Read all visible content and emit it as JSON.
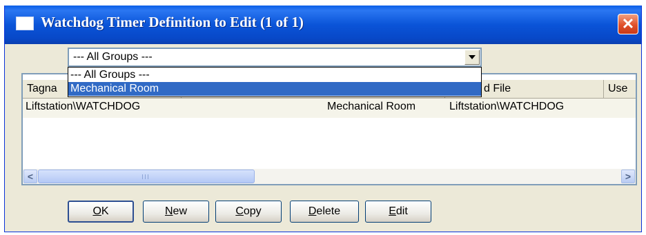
{
  "window": {
    "title": "Watchdog Timer Definition to Edit (1 of 1)",
    "close_glyph": "✕",
    "icons": {
      "app": "window-icon",
      "close": "close-icon"
    }
  },
  "group_filter": {
    "selected": "--- All Groups ---",
    "options": [
      "--- All Groups ---",
      "Mechanical Room"
    ],
    "highlighted": "Mechanical Room"
  },
  "table": {
    "columns": [
      "Tagna",
      "d File",
      "Use"
    ],
    "rows": [
      {
        "tagname": "Liftstation\\WATCHDOG",
        "group": "Mechanical Room",
        "file": "Liftstation\\WATCHDOG"
      }
    ]
  },
  "scrollbar": {
    "left_glyph": "<",
    "right_glyph": ">"
  },
  "buttons": {
    "ok": {
      "key": "O",
      "rest": "K"
    },
    "new": {
      "key": "N",
      "rest": "ew"
    },
    "copy": {
      "key": "C",
      "rest": "opy"
    },
    "delete": {
      "key": "D",
      "rest": "elete"
    },
    "edit": {
      "key": "E",
      "rest": "dit"
    }
  },
  "colors": {
    "title_bar": "#0a54d8",
    "selection": "#316ac5",
    "dialog_bg": "#ece9d8",
    "close_button": "#e0502a"
  }
}
